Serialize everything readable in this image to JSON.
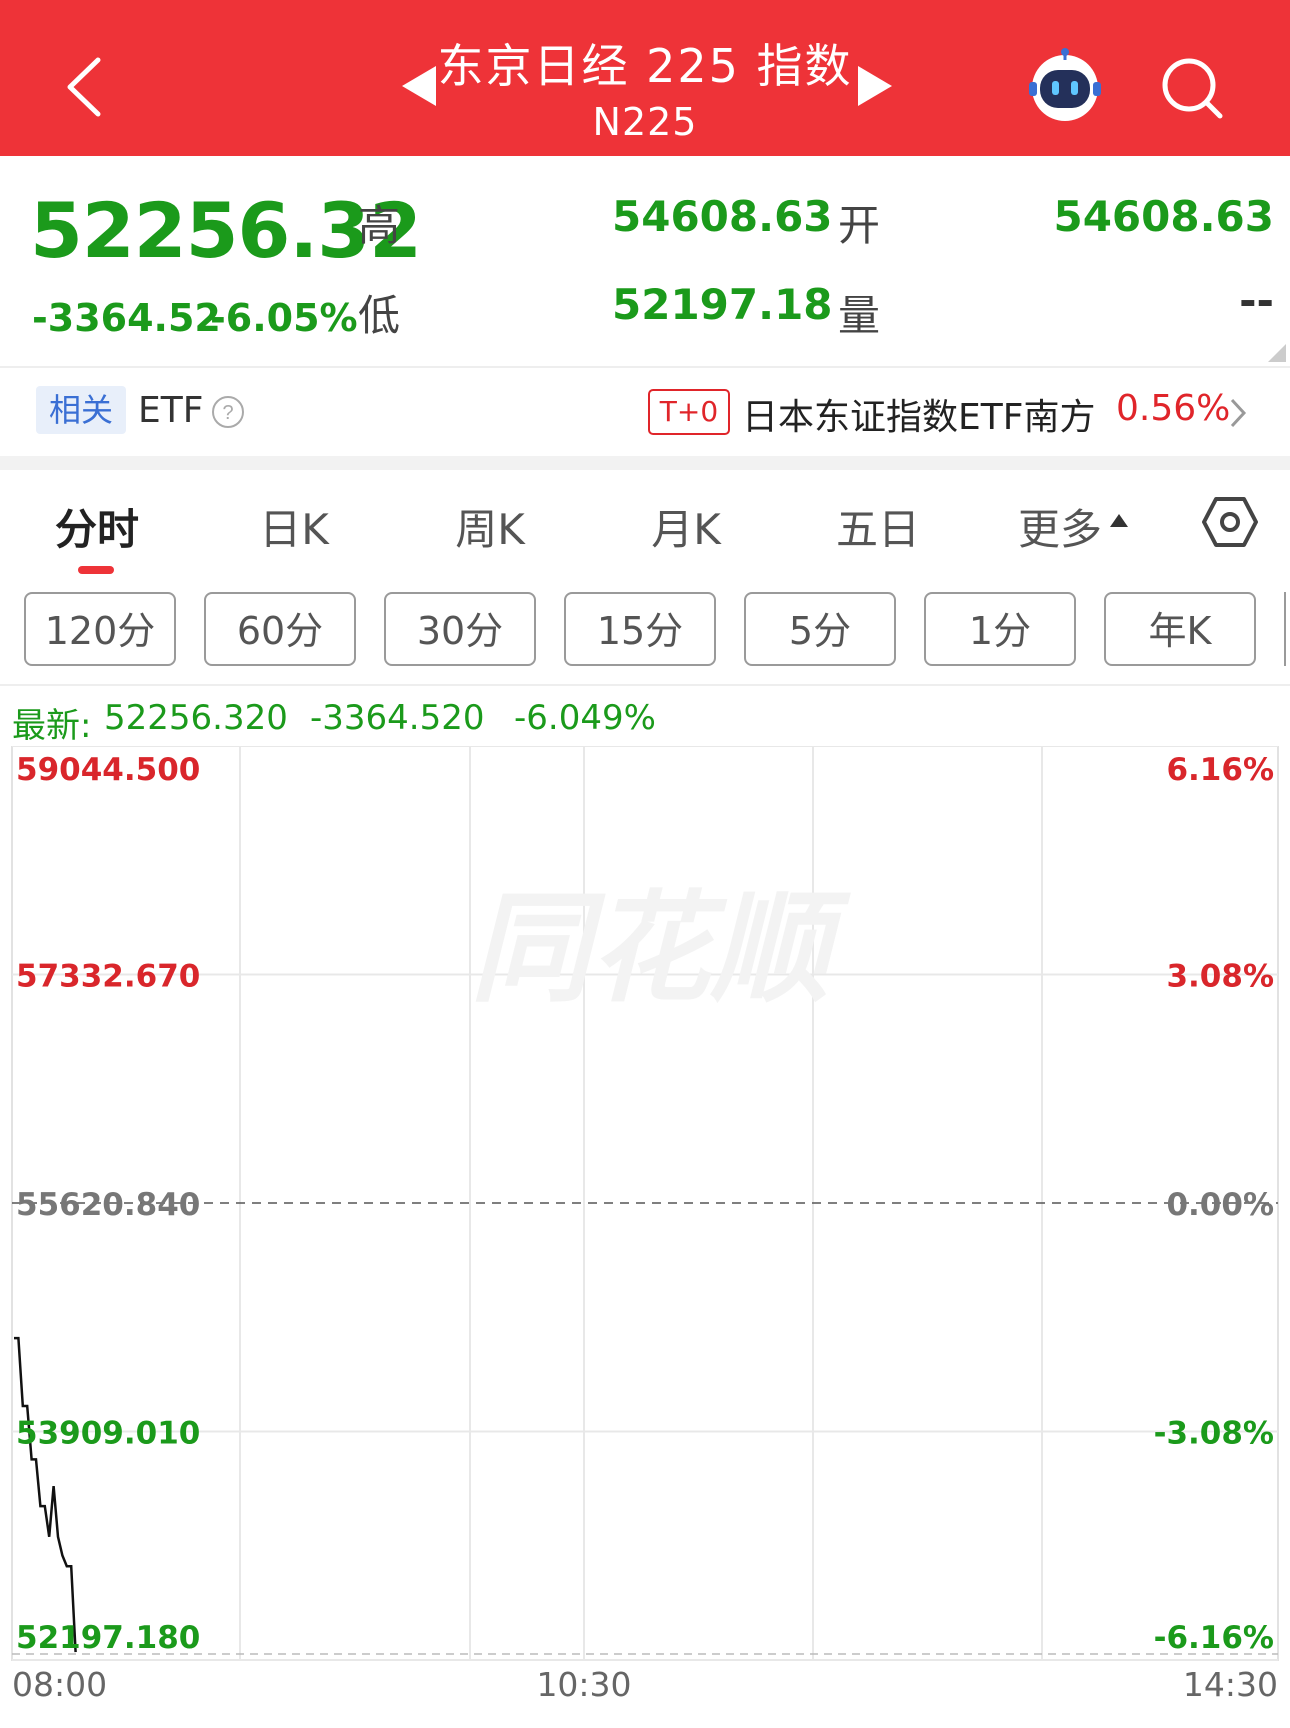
{
  "header": {
    "title": "东京日经 225 指数",
    "code": "N225"
  },
  "quote": {
    "price": "52256.32",
    "change": "-3364.52",
    "change_pct": "-6.05%",
    "high_label": "高",
    "high": "54608.63",
    "low_label": "低",
    "low": "52197.18",
    "open_label": "开",
    "open": "54608.63",
    "volume_label": "量",
    "volume": "--"
  },
  "etf": {
    "tag": "相关",
    "label": "ETF",
    "t0": "T+0",
    "name": "日本东证指数ETF南方",
    "pct": "0.56%"
  },
  "tabs": [
    "分时",
    "日K",
    "周K",
    "月K",
    "五日",
    "更多"
  ],
  "periods": [
    "120分",
    "60分",
    "30分",
    "15分",
    "5分",
    "1分",
    "年K"
  ],
  "latest": {
    "label": "最新:",
    "price": "52256.320",
    "change": "-3364.520",
    "pct": "-6.049%"
  },
  "chart_data": {
    "type": "line",
    "title": "",
    "y_left_ticks": [
      "59044.500",
      "57332.670",
      "55620.840",
      "53909.010",
      "52197.180"
    ],
    "y_right_ticks": [
      "6.16%",
      "3.08%",
      "0.00%",
      "-3.08%",
      "-6.16%"
    ],
    "x_ticks": [
      "08:00",
      "10:30",
      "14:30"
    ],
    "ylim": [
      52197.18,
      59044.5
    ],
    "prev_close": 55620.84,
    "watermark": "同花顺",
    "series": [
      {
        "values": [
          54608.63,
          54608.63,
          54100.0,
          54100.0,
          53700.0,
          53700.0,
          53350.0,
          53350.0,
          53120.0,
          53500.0,
          53120.0,
          52980.0,
          52900.0,
          52900.0,
          52256.32
        ]
      }
    ]
  },
  "colors": {
    "header_bg": "#ee3338",
    "up": "#e0252a",
    "down": "#1b9a1b"
  }
}
